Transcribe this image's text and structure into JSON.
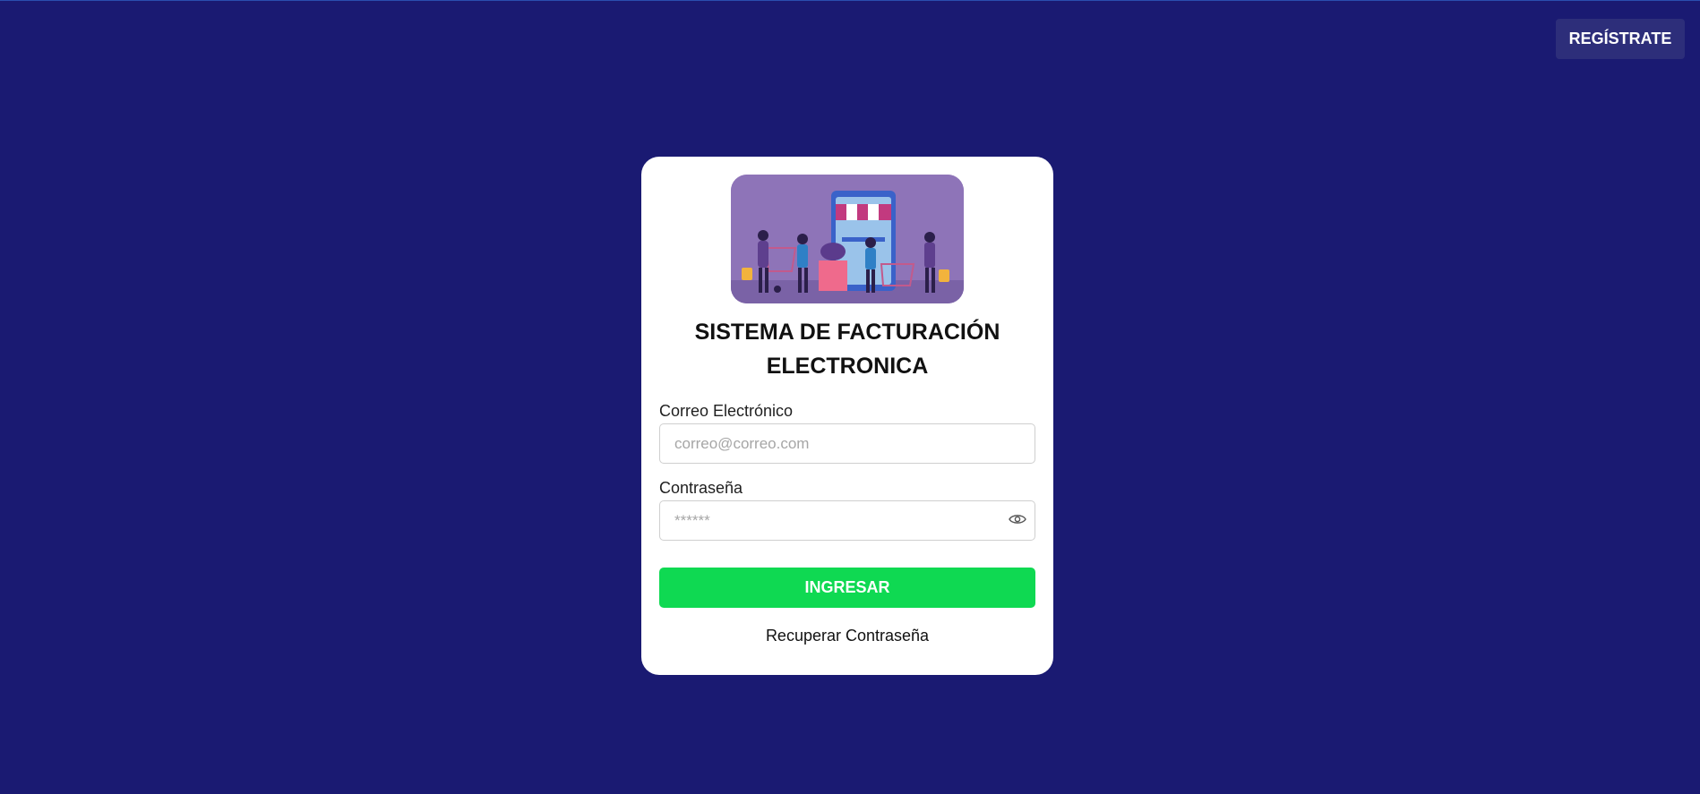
{
  "header": {
    "register_label": "REGÍSTRATE"
  },
  "card": {
    "title": "SISTEMA DE FACTURACIÓN ELECTRONICA",
    "email": {
      "label": "Correo Electrónico",
      "placeholder": "correo@correo.com",
      "value": ""
    },
    "password": {
      "label": "Contraseña",
      "placeholder": "******",
      "value": ""
    },
    "submit_label": "INGRESAR",
    "recover_label": "Recuperar Contraseña"
  },
  "colors": {
    "background": "#1a1a72",
    "register_button": "#2d2e7a",
    "submit_button": "#0fd952",
    "card": "#ffffff"
  },
  "icons": {
    "password_toggle": "eye-icon"
  }
}
